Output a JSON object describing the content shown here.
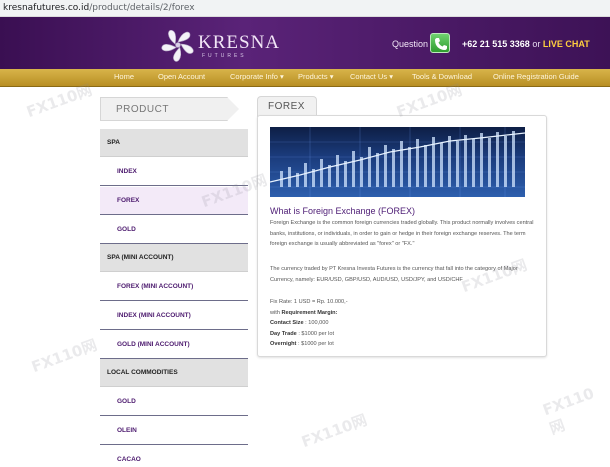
{
  "browser": {
    "url_host": "kresnafutures.co.id",
    "url_path": "/product/details/2/forex"
  },
  "header": {
    "brand": "KRESNA",
    "brand_sub": "FUTURES",
    "question": "Question ?",
    "phone_number": "+62 21 515 3368",
    "or_text": "or",
    "live_chat": "LIVE CHAT"
  },
  "nav": {
    "items": [
      "Home",
      "Open Account",
      "Corporate Info",
      "Products",
      "Contact Us",
      "Tools & Download",
      "Online Registration Guide"
    ]
  },
  "sidebar": {
    "title": "PRODUCT",
    "menu": [
      {
        "type": "head",
        "label": "SPA"
      },
      {
        "type": "sub",
        "label": "INDEX"
      },
      {
        "type": "sub",
        "label": "FOREX",
        "active": true
      },
      {
        "type": "sub",
        "label": "GOLD"
      },
      {
        "type": "head",
        "label": "SPA (MINI ACCOUNT)"
      },
      {
        "type": "sub",
        "label": "FOREX (MINI ACCOUNT)"
      },
      {
        "type": "sub",
        "label": "INDEX (MINI ACCOUNT)"
      },
      {
        "type": "sub",
        "label": "GOLD (MINI ACCOUNT)"
      },
      {
        "type": "head",
        "label": "LOCAL COMMODITIES"
      },
      {
        "type": "sub",
        "label": "GOLD"
      },
      {
        "type": "sub",
        "label": "OLEIN"
      },
      {
        "type": "sub",
        "label": "CACAO"
      }
    ]
  },
  "content": {
    "tab": "FOREX",
    "heading": "What is Foreign Exchange (FOREX)",
    "para1": [
      "Foreign Exchange is the common foreign currencies traded globally. This product normally involves central",
      "banks, institutions, or individuals, in order to gain or hedge in their foreign exchange reserves. The term",
      "foreign exchange is usually abbreviated as \"forex\" or \"FX.\""
    ],
    "para2": [
      "The currency traded by PT Kresna Investa Futures is the currency that fall into the category of Major",
      "Currency, namely: EUR/USD, GBP/USD, AUD/USD, USD/JPY, and USD/CHF"
    ],
    "fix_rate": "Fix Rate: 1 USD = Rp. 10.000,-",
    "with_label": "with",
    "req_margin": "Requirement Margin:",
    "specs": [
      {
        "label": "Contact Size",
        "value": ": 100,000"
      },
      {
        "label": "Day Trade",
        "value": ": $1000 per lot"
      },
      {
        "label": "Overnight",
        "value": ": $1000 per lot"
      }
    ]
  },
  "watermark": "FX110网",
  "colors": {
    "purple": "#4c1a6e",
    "gold": "#c9a23a",
    "accent_chat": "#ffcf3f"
  }
}
